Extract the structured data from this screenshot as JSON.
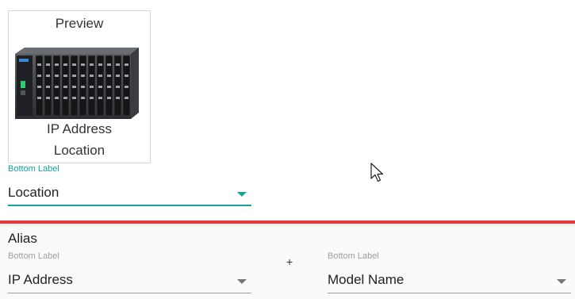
{
  "preview": {
    "title": "Preview",
    "line1": "IP Address",
    "line2": "Location"
  },
  "bottom_label_field": {
    "label": "Bottom Label",
    "value": "Location"
  },
  "alias": {
    "title": "Alias",
    "left_field": {
      "label": "Bottom Label",
      "value": "IP Address"
    },
    "plus": "+",
    "right_field": {
      "label": "Bottom Label",
      "value": "Model Name"
    }
  },
  "colors": {
    "accent": "#14a39a",
    "divider": "#e5393d"
  },
  "icons": [
    "device-image",
    "dropdown-caret-icon",
    "mouse-pointer-icon"
  ]
}
